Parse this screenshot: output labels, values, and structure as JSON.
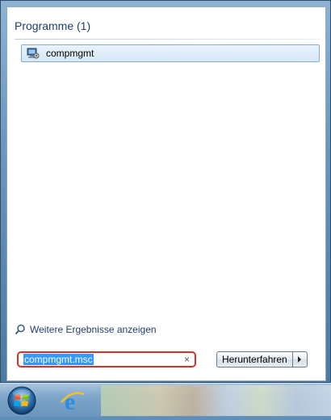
{
  "results": {
    "header": "Programme (1)",
    "items": [
      {
        "label": "compmgmt",
        "icon": "computer-management-icon"
      }
    ]
  },
  "more_results_label": "Weitere Ergebnisse anzeigen",
  "search": {
    "value": "compmgmt.msc",
    "clear_symbol": "×"
  },
  "shutdown": {
    "label": "Herunterfahren"
  },
  "taskbar": {
    "pinned": [
      "start-orb",
      "internet-explorer-icon"
    ]
  },
  "colors": {
    "highlight_border": "#e02b2b",
    "selection": "#3399ff",
    "header_text": "#1e3f6e"
  }
}
